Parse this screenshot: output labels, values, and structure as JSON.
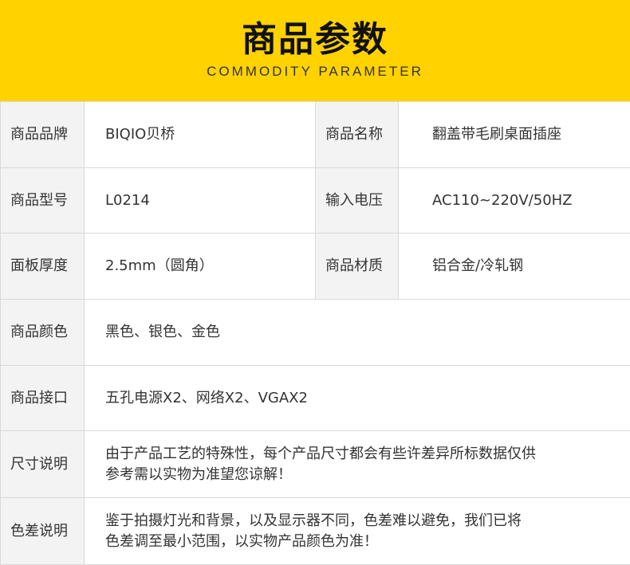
{
  "header": {
    "title": "商品参数",
    "subtitle": "COMMODITY PARAMETER"
  },
  "rows": [
    {
      "label1": "商品品牌",
      "value1": "BIQIO贝桥",
      "label2": "商品名称",
      "value2": "翻盖带毛刷桌面插座"
    },
    {
      "label1": "商品型号",
      "value1": "L0214",
      "label2": "输入电压",
      "value2": "AC110~220V/50HZ"
    },
    {
      "label1": "面板厚度",
      "value1": "2.5mm（圆角）",
      "label2": "商品材质",
      "value2": "铝合金/冷轧钢"
    },
    {
      "label": "商品颜色",
      "value": "黑色、银色、金色"
    },
    {
      "label": "商品接口",
      "value": "五孔电源X2、网络X2、VGAX2"
    },
    {
      "label": "尺寸说明",
      "line1": "由于产品工艺的特殊性，每个产品尺寸都会有些许差异所标数据仅供",
      "line2": "参考需以实物为准望您谅解！"
    },
    {
      "label": "色差说明",
      "line1": "鉴于拍摄灯光和背景，以及显示器不同，色差难以避免，我们已将",
      "line2": "色差调至最小范围，以实物产品颜色为准！"
    }
  ],
  "colors": {
    "header_bg": "#ffd200",
    "label_bg": "#f3f3f3",
    "border": "#d9d9d9"
  }
}
